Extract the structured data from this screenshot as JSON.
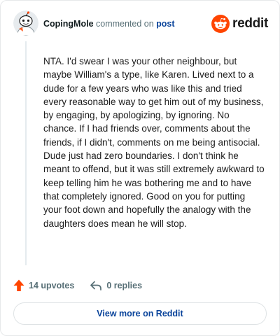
{
  "comment": {
    "username": "CopingMole",
    "action_text": " commented on ",
    "post_link_text": "post",
    "body": "NTA. I'd swear I was your other neighbour, but maybe William's a type, like Karen. Lived next to a dude for a few years who was like this and tried every reasonable way to get him out of my business, by engaging, by apologizing, by ignoring. No chance. If I had friends over, comments about the friends, if I didn't, comments on me being antisocial. Dude just had zero boundaries. I don't think he meant to offend, but it was still extremely awkward to keep telling him he was bothering me and to have that completely ignored. Good on you for putting your foot down and hopefully the analogy with the daughters does mean he will stop."
  },
  "brand": {
    "wordmark": "reddit",
    "color": "#ff4500"
  },
  "stats": {
    "upvotes_label": "14 upvotes",
    "replies_label": "0 replies"
  },
  "footer": {
    "view_more_label": "View more on Reddit"
  },
  "icons": {
    "avatar": "snoo-avatar",
    "logo": "reddit-snoo-icon",
    "upvote": "upvote-arrow-icon",
    "reply": "reply-arrow-icon"
  },
  "colors": {
    "upvote_accent": "#ff4500",
    "link": "#0a449b",
    "muted_text": "#576f76",
    "body_text": "#1c1c1c"
  }
}
